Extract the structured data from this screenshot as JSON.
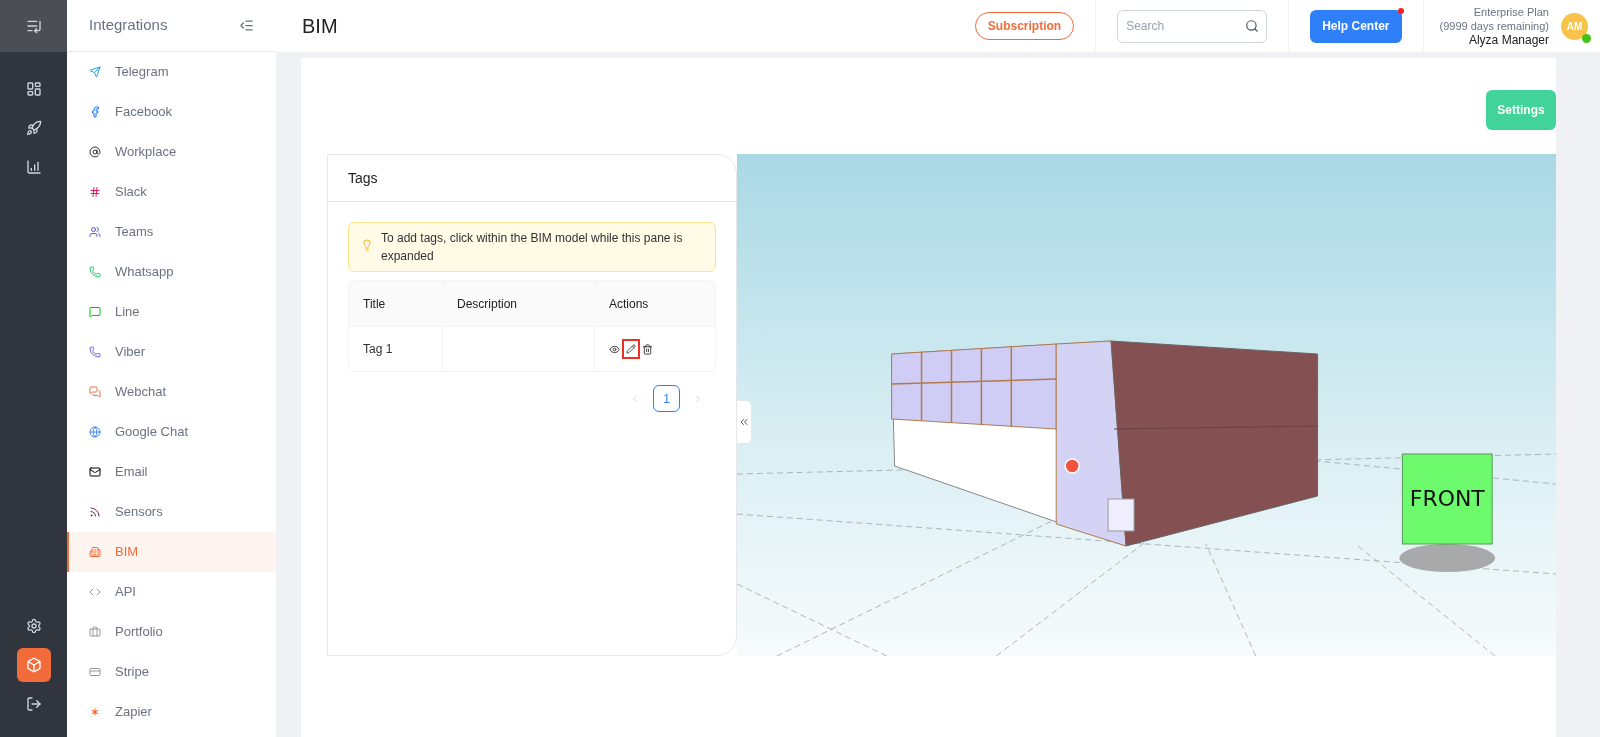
{
  "rail": {
    "items": [
      {
        "selected": false
      },
      {
        "selected": false
      },
      {
        "selected": false
      },
      {
        "selected": false
      },
      {
        "selected": true
      },
      {
        "selected": false
      }
    ]
  },
  "sidebar": {
    "title": "Integrations",
    "items": [
      {
        "label": "Telegram",
        "selected": false
      },
      {
        "label": "Facebook",
        "selected": false
      },
      {
        "label": "Workplace",
        "selected": false
      },
      {
        "label": "Slack",
        "selected": false
      },
      {
        "label": "Teams",
        "selected": false
      },
      {
        "label": "Whatsapp",
        "selected": false
      },
      {
        "label": "Line",
        "selected": false
      },
      {
        "label": "Viber",
        "selected": false
      },
      {
        "label": "Webchat",
        "selected": false
      },
      {
        "label": "Google Chat",
        "selected": false
      },
      {
        "label": "Email",
        "selected": false
      },
      {
        "label": "Sensors",
        "selected": false
      },
      {
        "label": "BIM",
        "selected": true
      },
      {
        "label": "API",
        "selected": false
      },
      {
        "label": "Portfolio",
        "selected": false
      },
      {
        "label": "Stripe",
        "selected": false
      },
      {
        "label": "Zapier",
        "selected": false
      }
    ]
  },
  "header": {
    "title": "BIM",
    "subscription": "Subscription",
    "search": {
      "placeholder": "Search"
    },
    "help_center": {
      "label": "Help Center",
      "notification": true
    },
    "plan": "Enterprise Plan",
    "days": "(9999 days remaining)",
    "user": "Alyza Manager",
    "avatar": "AM",
    "online": true
  },
  "settings_button": "Settings",
  "tags_panel": {
    "title": "Tags",
    "hint": "To add tags, click within the BIM model while this pane is expanded",
    "columns": [
      "Title",
      "Description",
      "Actions"
    ],
    "rows": [
      {
        "title": "Tag 1",
        "edit_highlighted": true
      }
    ],
    "pagination": {
      "pages": [
        {
          "label": "1",
          "selected": true
        }
      ],
      "prev_disabled": true,
      "next_disabled": true
    }
  },
  "viewer": {
    "cube_label": "FRONT"
  }
}
